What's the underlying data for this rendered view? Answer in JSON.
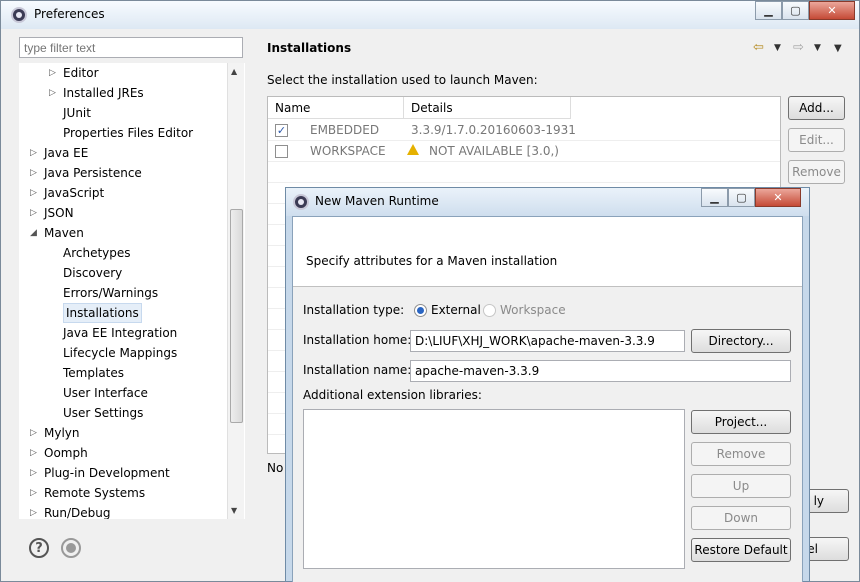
{
  "window": {
    "title": "Preferences"
  },
  "filter": {
    "placeholder": "type filter text"
  },
  "tree": {
    "items": [
      {
        "label": "Editor",
        "level": 2,
        "arrow": "▷"
      },
      {
        "label": "Installed JREs",
        "level": 2,
        "arrow": "▷"
      },
      {
        "label": "JUnit",
        "level": 2,
        "arrow": ""
      },
      {
        "label": "Properties Files Editor",
        "level": 2,
        "arrow": ""
      },
      {
        "label": "Java EE",
        "level": 1,
        "arrow": "▷"
      },
      {
        "label": "Java Persistence",
        "level": 1,
        "arrow": "▷"
      },
      {
        "label": "JavaScript",
        "level": 1,
        "arrow": "▷"
      },
      {
        "label": "JSON",
        "level": 1,
        "arrow": "▷"
      },
      {
        "label": "Maven",
        "level": 1,
        "arrow": "◢"
      },
      {
        "label": "Archetypes",
        "level": 2,
        "arrow": ""
      },
      {
        "label": "Discovery",
        "level": 2,
        "arrow": ""
      },
      {
        "label": "Errors/Warnings",
        "level": 2,
        "arrow": ""
      },
      {
        "label": "Installations",
        "level": 2,
        "arrow": "",
        "selected": true
      },
      {
        "label": "Java EE Integration",
        "level": 2,
        "arrow": ""
      },
      {
        "label": "Lifecycle Mappings",
        "level": 2,
        "arrow": ""
      },
      {
        "label": "Templates",
        "level": 2,
        "arrow": ""
      },
      {
        "label": "User Interface",
        "level": 2,
        "arrow": ""
      },
      {
        "label": "User Settings",
        "level": 2,
        "arrow": ""
      },
      {
        "label": "Mylyn",
        "level": 1,
        "arrow": "▷"
      },
      {
        "label": "Oomph",
        "level": 1,
        "arrow": "▷"
      },
      {
        "label": "Plug-in Development",
        "level": 1,
        "arrow": "▷"
      },
      {
        "label": "Remote Systems",
        "level": 1,
        "arrow": "▷"
      },
      {
        "label": "Run/Debug",
        "level": 1,
        "arrow": "▷"
      }
    ]
  },
  "panel": {
    "title": "Installations",
    "subtitle": "Select the installation used to launch Maven:",
    "columns": [
      "Name",
      "Details"
    ],
    "rows": [
      {
        "checked": true,
        "name": "EMBEDDED",
        "details": "3.3.9/1.7.0.20160603-1931",
        "warning": false
      },
      {
        "checked": false,
        "name": "WORKSPACE",
        "details": "NOT AVAILABLE [3.0,)",
        "warning": true
      }
    ],
    "buttons": {
      "add": "Add...",
      "edit": "Edit...",
      "remove": "Remove"
    },
    "note_fragment": "No",
    "apply_fragment": "ly",
    "cancel_fragment": "el"
  },
  "dialog": {
    "title": "New Maven Runtime",
    "description": "Specify attributes for a Maven installation",
    "installation_type_label": "Installation type:",
    "type_external": "External",
    "type_workspace": "Workspace",
    "installation_home_label": "Installation home:",
    "installation_home_value": "D:\\LIUF\\XHJ_WORK\\apache-maven-3.3.9",
    "directory_button": "Directory...",
    "installation_name_label": "Installation name:",
    "installation_name_value": "apache-maven-3.3.9",
    "ext_libs_label": "Additional extension libraries:",
    "buttons": {
      "project": "Project...",
      "remove": "Remove",
      "up": "Up",
      "down": "Down",
      "restore": "Restore Default"
    }
  }
}
